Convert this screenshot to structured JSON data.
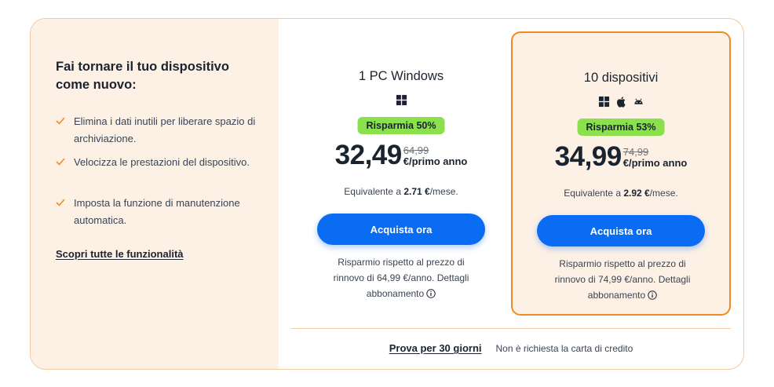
{
  "left": {
    "title": "Fai tornare il tuo dispositivo come nuovo:",
    "features": [
      "Elimina i dati inutili per liberare spazio di archiviazione.",
      "Velocizza le prestazioni del dispositivo.",
      "Imposta la funzione di manutenzione automatica."
    ],
    "discover_link": "Scopri tutte le funzionalità"
  },
  "plans": [
    {
      "name": "1 PC Windows",
      "icons": [
        "windows-icon"
      ],
      "badge": "Risparmia 50%",
      "price": "32,49",
      "old_price": "64,99",
      "unit": "€/primo anno",
      "equiv_prefix": "Equivalente a ",
      "equiv_value": "2.71 €",
      "equiv_suffix": "/mese.",
      "button": "Acquista ora",
      "renew_note": "Risparmio rispetto al prezzo di rinnovo di 64,99 €/anno. Dettagli abbonamento"
    },
    {
      "name": "10 dispositivi",
      "icons": [
        "windows-icon",
        "apple-icon",
        "android-icon"
      ],
      "badge": "Risparmia 53%",
      "price": "34,99",
      "old_price": "74,99",
      "unit": "€/primo anno",
      "equiv_prefix": "Equivalente a ",
      "equiv_value": "2.92 €",
      "equiv_suffix": "/mese.",
      "button": "Acquista ora",
      "renew_note": "Risparmio rispetto al prezzo di rinnovo di 74,99 €/anno. Dettagli abbonamento"
    }
  ],
  "trial": {
    "link": "Prova per 30 giorni",
    "note": "Non è richiesta la carta di credito"
  },
  "colors": {
    "accent": "#f08a24",
    "button": "#0a6cf2",
    "badge": "#8be04e",
    "panel": "#fdf1e6"
  }
}
